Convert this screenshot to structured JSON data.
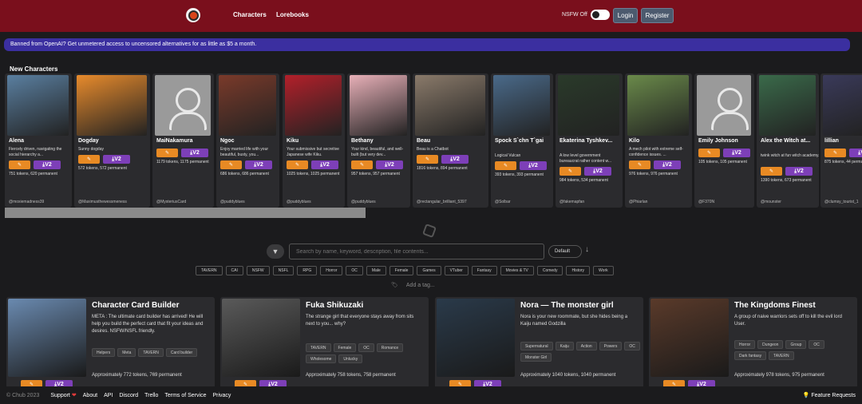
{
  "nav": {
    "characters": "Characters",
    "lorebooks": "Lorebooks",
    "nsfw_label": "NSFW Off",
    "login": "Login",
    "register": "Register"
  },
  "banner": "Banned from OpenAI? Get unmetered access to uncensored alternatives for as little as $5 a month.",
  "new_characters_title": "New Characters",
  "new_characters": [
    {
      "name": "Alena",
      "desc": "Fiercely driven, navigating the social hierarchy a...",
      "tokens": "751 tokens, 620 permanent",
      "author": "@moxiemadness39",
      "v2": "V2",
      "color": "#5a7fa0"
    },
    {
      "name": "Dogday",
      "desc": "Sunny dogday",
      "tokens": "572 tokens, 572 permanent",
      "author": "@Maximusthewessmeness",
      "v2": "V2",
      "color": "#e88b2c"
    },
    {
      "name": "MaiNakamura",
      "desc": "",
      "tokens": "1179 tokens, 1175 permanent",
      "author": "@MysteriusCard",
      "v2": "V2",
      "color": "avatar"
    },
    {
      "name": "Ngoc",
      "desc": "Enjoy married life with your beautiful, busty, you...",
      "tokens": "686 tokens, 686 permanent",
      "author": "@puddyblues",
      "v2": "V2",
      "color": "#7a3a2a"
    },
    {
      "name": "Kiku",
      "desc": "Your submissive but secretive Japanese wife Kiku.",
      "tokens": "1025 tokens, 1025 permanent",
      "author": "@puddyblues",
      "v2": "V2",
      "color": "#b3202a"
    },
    {
      "name": "Bethany",
      "desc": "Your kind, beautiful, and well-built (but very dev...",
      "tokens": "957 tokens, 957 permanent",
      "author": "@puddyblues",
      "v2": "V2",
      "color": "#e8b0b8"
    },
    {
      "name": "Beau",
      "desc": "Beau is a Chatbot",
      "tokens": "1816 tokens, 894 permanent",
      "author": "@rectangular_brilliant_5397",
      "v2": "V2",
      "color": "#8a7a6a"
    },
    {
      "name": "Spock S`chn T`gai",
      "desc": "Logical Vulcan",
      "tokens": "393 tokens, 393 permanent",
      "author": "@Solbar",
      "v2": "V2",
      "color": "#4a6a8a"
    },
    {
      "name": "Ekaterina Tyshkev...",
      "desc": "A low level government bureaucrat rather content w...",
      "tokens": "984 tokens, 534 permanent",
      "author": "@fakemapfan",
      "v2": "V2",
      "color": "#2a3a2a"
    },
    {
      "name": "Kilo",
      "desc": "A mech pilot with extreme self-confidence issues. ...",
      "tokens": "976 tokens, 976 permanent",
      "author": "@Phiarlan",
      "v2": "V2",
      "color": "#6a8a4a"
    },
    {
      "name": "Emily Johnson",
      "desc": "",
      "tokens": "105 tokens, 105 permanent",
      "author": "@F370N",
      "v2": "V2",
      "color": "avatar"
    },
    {
      "name": "Alex the Witch at...",
      "desc": "twink witch at fun witch academy.",
      "tokens": "1390 tokens, 673 permanent",
      "author": "@mounster",
      "v2": "V2",
      "color": "#3a6a4a"
    },
    {
      "name": "lillian",
      "desc": "",
      "tokens": "875 tokens, 44 permanent",
      "author": "@clumsy_tourist_1",
      "v2": "V2",
      "color": "#3a3a5a"
    }
  ],
  "search": {
    "placeholder": "Search by name, keyword, description, file contents...",
    "sort": "Default",
    "add_tag": "Add a tag..."
  },
  "tags": [
    "TAVERN",
    "CAI",
    "NSFW",
    "NSFL",
    "RPG",
    "Horror",
    "OC",
    "Male",
    "Female",
    "Games",
    "VTuber",
    "Fantasy",
    "Movies & TV",
    "Comedy",
    "History",
    "Work"
  ],
  "featured": [
    {
      "title": "Character Card Builder",
      "desc": "META : The ultimate card builder has arrived! He will help you build the perfect card that fit your ideas and desires. NSFW/NSFL friendly.",
      "tags": [
        "Helpers",
        "Meta",
        "TAVERN",
        "Card builder"
      ],
      "tokens": "Approximately 772 tokens, 769 permanent",
      "v2": "V2",
      "color": "#6a8ab0"
    },
    {
      "title": "Fuka Shikuzaki",
      "desc": "The strange girl that everyone stays away from sits next to you... why?",
      "tags": [
        "TAVERN",
        "Female",
        "OC",
        "Romance",
        "Wholesome",
        "Unlucky"
      ],
      "tokens": "Approximately 758 tokens, 758 permanent",
      "v2": "V2",
      "color": "#5a5a5a"
    },
    {
      "title": "Nora — The monster girl",
      "desc": "Nora is your new roommate, but she hides being a Kaiju named Godzilla",
      "tags": [
        "Supernatural",
        "Kaiju",
        "Action",
        "Powers",
        "OC",
        "Monster Girl"
      ],
      "tokens": "Approximately 1040 tokens, 1040 permanent",
      "v2": "V2",
      "color": "#2a3a4a"
    },
    {
      "title": "The Kingdoms Finest",
      "desc": "A group of naive warriors sets off to kill the evil lord User.",
      "tags": [
        "Horror",
        "Dungeon",
        "Group",
        "OC",
        "Dark fantasy",
        "TAVERN"
      ],
      "tokens": "Approximately 978 tokens, 975 permanent",
      "v2": "V2",
      "color": "#5a3a2a"
    }
  ],
  "footer": {
    "copyright": "© Chub 2023",
    "support": "Support",
    "about": "About",
    "api": "API",
    "discord": "Discord",
    "trello": "Trello",
    "tos": "Terms of Service",
    "privacy": "Privacy",
    "feature_requests": "Feature Requests"
  }
}
